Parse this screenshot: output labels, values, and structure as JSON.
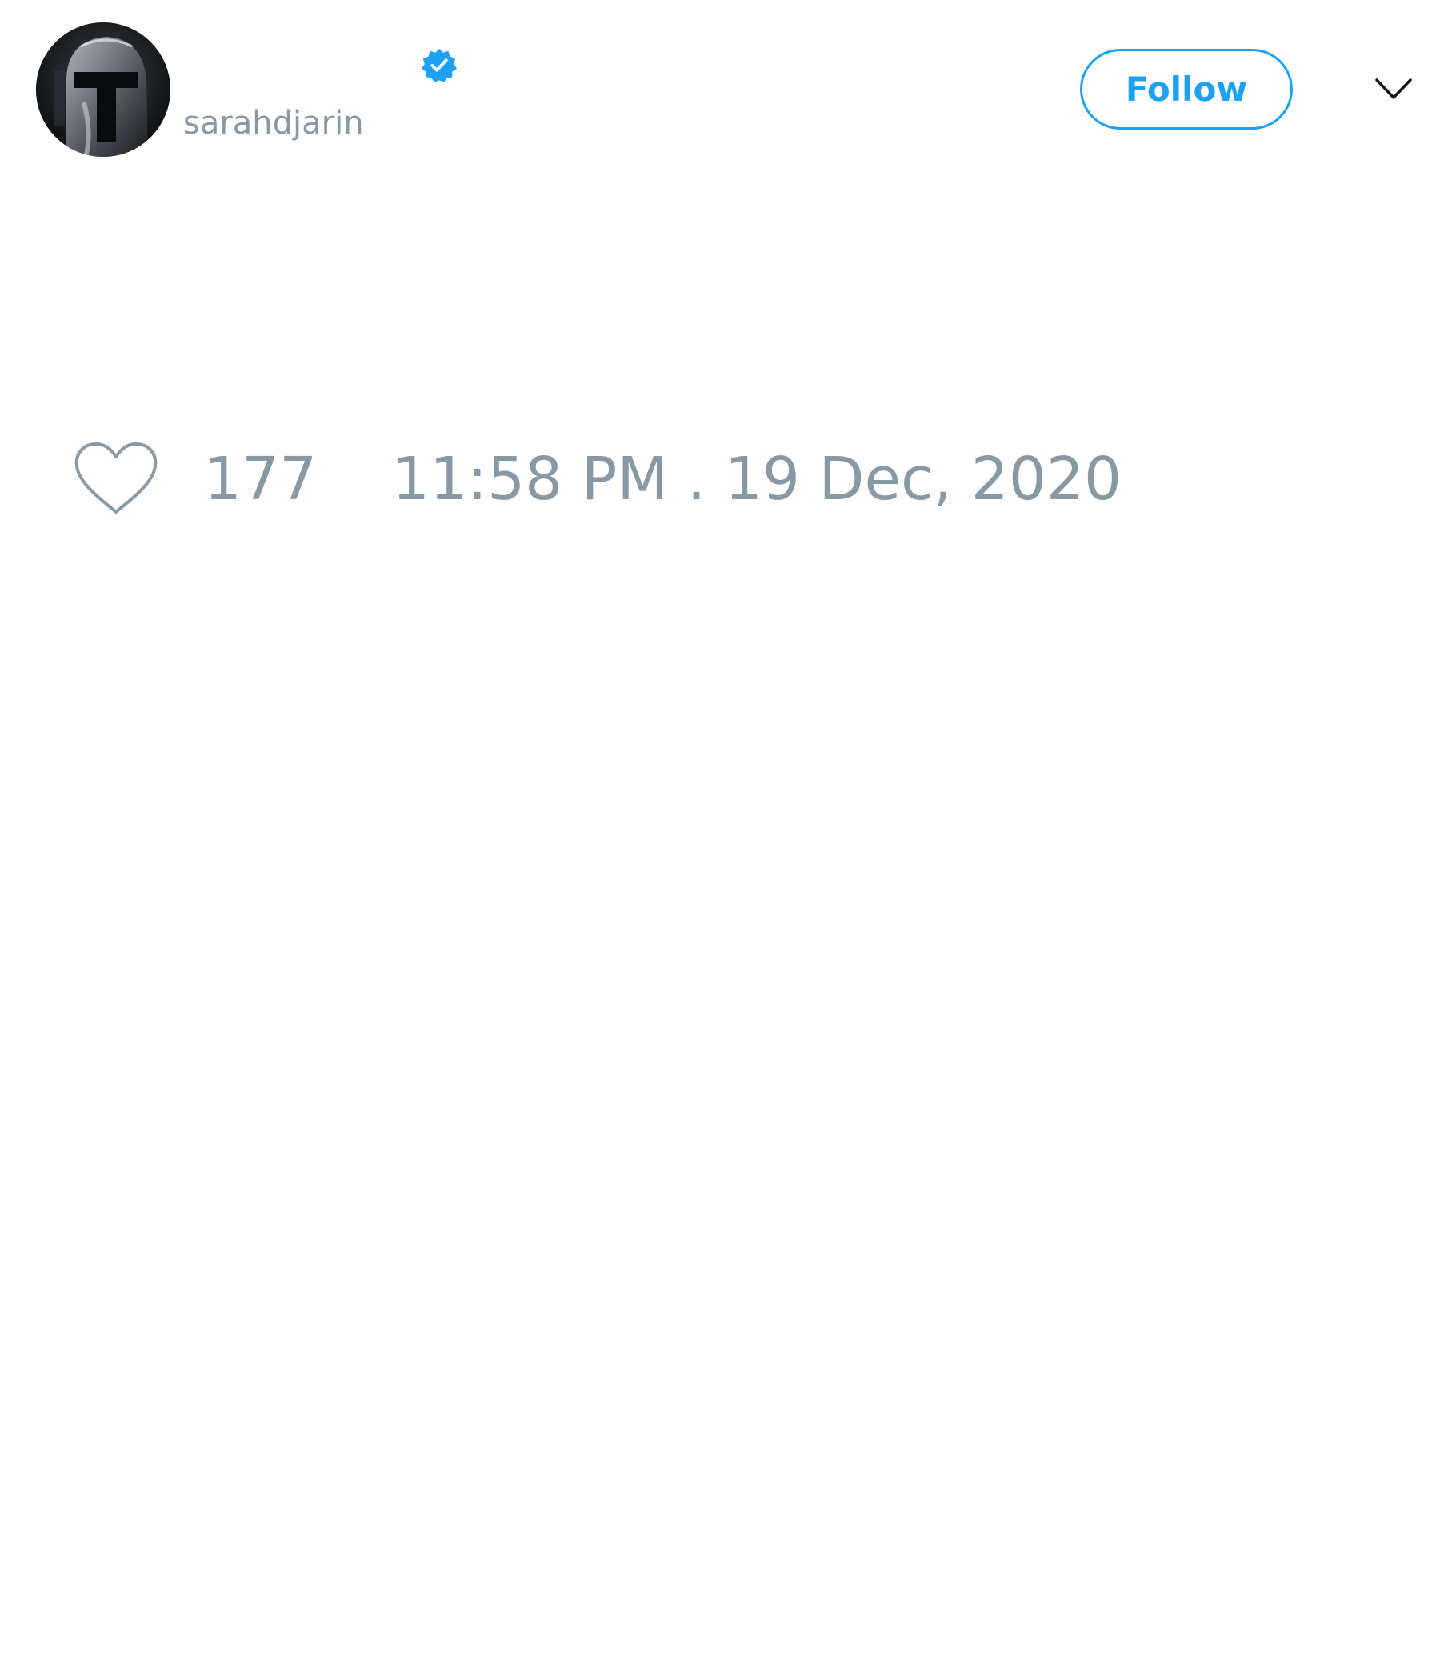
{
  "tweet": {
    "author": {
      "display_name": "",
      "handle": "sarahdjarin",
      "verified": true,
      "avatar_icon": "helmet-avatar-icon"
    },
    "follow_label": "Follow",
    "menu_icon": "chevron-down-icon",
    "likes": {
      "icon": "heart-outline-icon",
      "count": "177"
    },
    "timestamp": "11:58 PM . 19 Dec, 2020"
  },
  "colors": {
    "accent": "#1da1f2",
    "muted_text": "#8899a6",
    "background": "#ffffff"
  }
}
